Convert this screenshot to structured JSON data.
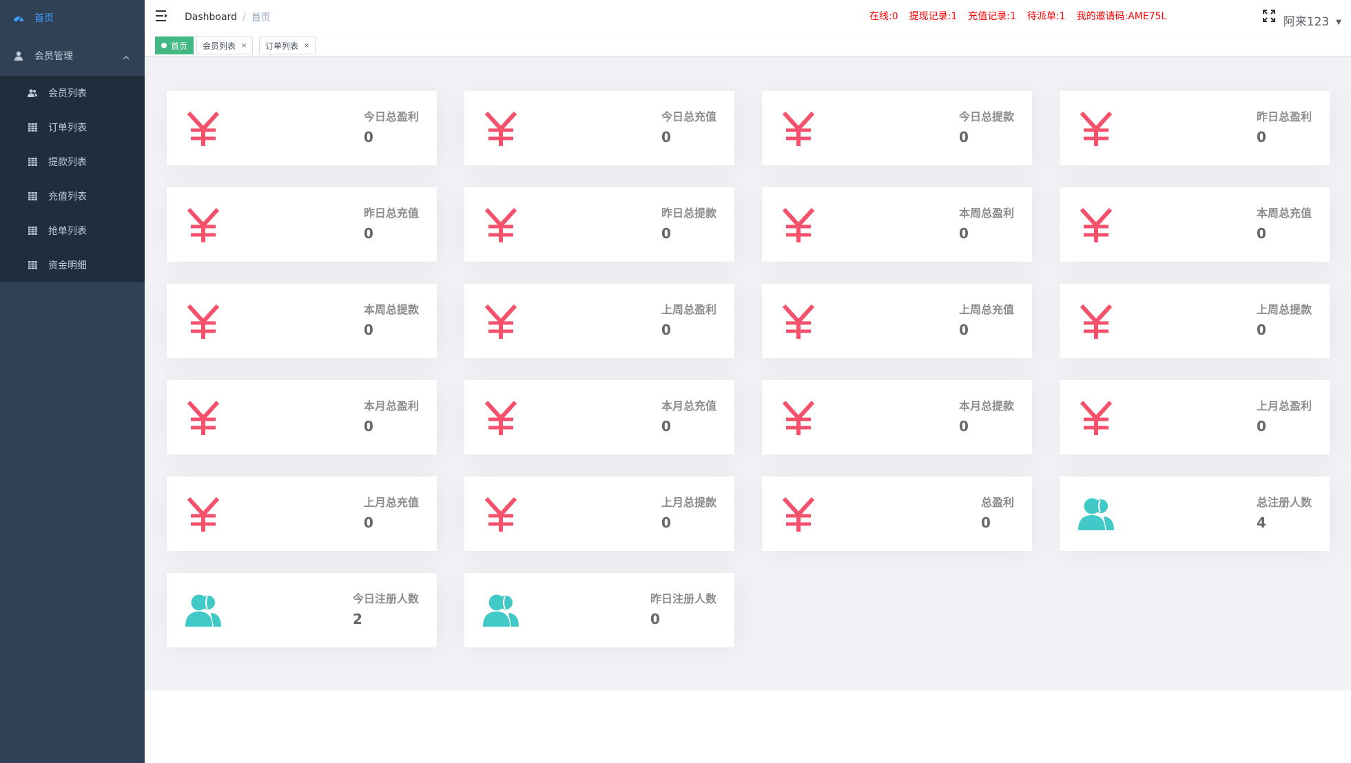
{
  "sidebar": {
    "top_item": "首页",
    "group_label": "会员管理",
    "items": [
      "会员列表",
      "订单列表",
      "提款列表",
      "充值列表",
      "抢单列表",
      "资金明细"
    ]
  },
  "navbar": {
    "breadcrumb_root": "Dashboard",
    "breadcrumb_sep": "/",
    "breadcrumb_current": "首页",
    "stats": [
      "在线:0",
      "提现记录:1",
      "充值记录:1",
      "待派单:1",
      "我的邀请码:AME75L"
    ],
    "username": "阿来123",
    "caret": "▼"
  },
  "tags": [
    {
      "label": "首页"
    },
    {
      "label": "会员列表",
      "close": "×"
    },
    {
      "label": "订单列表",
      "close": "×"
    }
  ],
  "cards": [
    {
      "label": "今日总盈利",
      "value": "0",
      "icon": "yen-icon"
    },
    {
      "label": "今日总充值",
      "value": "0",
      "icon": "yen-icon"
    },
    {
      "label": "今日总提款",
      "value": "0",
      "icon": "yen-icon"
    },
    {
      "label": "昨日总盈利",
      "value": "0",
      "icon": "yen-icon"
    },
    {
      "label": "昨日总充值",
      "value": "0",
      "icon": "yen-icon"
    },
    {
      "label": "昨日总提款",
      "value": "0",
      "icon": "yen-icon"
    },
    {
      "label": "本周总盈利",
      "value": "0",
      "icon": "yen-icon"
    },
    {
      "label": "本周总充值",
      "value": "0",
      "icon": "yen-icon"
    },
    {
      "label": "本周总提款",
      "value": "0",
      "icon": "yen-icon"
    },
    {
      "label": "上周总盈利",
      "value": "0",
      "icon": "yen-icon"
    },
    {
      "label": "上周总充值",
      "value": "0",
      "icon": "yen-icon"
    },
    {
      "label": "上周总提款",
      "value": "0",
      "icon": "yen-icon"
    },
    {
      "label": "本月总盈利",
      "value": "0",
      "icon": "yen-icon"
    },
    {
      "label": "本月总充值",
      "value": "0",
      "icon": "yen-icon"
    },
    {
      "label": "本月总提款",
      "value": "0",
      "icon": "yen-icon"
    },
    {
      "label": "上月总盈利",
      "value": "0",
      "icon": "yen-icon"
    },
    {
      "label": "上月总充值",
      "value": "0",
      "icon": "yen-icon"
    },
    {
      "label": "上月总提款",
      "value": "0",
      "icon": "yen-icon"
    },
    {
      "label": "总盈利",
      "value": "0",
      "icon": "yen-icon"
    },
    {
      "label": "总注册人数",
      "value": "4",
      "icon": "people-icon"
    },
    {
      "label": "今日注册人数",
      "value": "2",
      "icon": "people-icon"
    },
    {
      "label": "昨日注册人数",
      "value": "0",
      "icon": "people-icon"
    }
  ],
  "colors": {
    "sidebar_bg": "#304156",
    "submenu_bg": "#1f2d3d",
    "active_menu": "#409eff",
    "yen_icon": "#f4516c",
    "people_icon": "#40c9c6",
    "tag_active": "#42b983",
    "stats_text": "#ff0000"
  }
}
